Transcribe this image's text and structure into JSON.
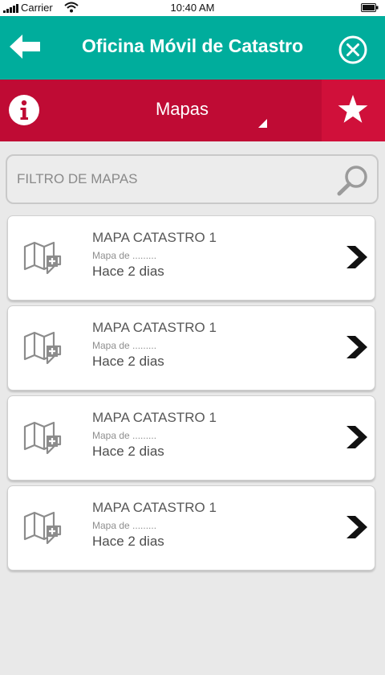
{
  "status_bar": {
    "carrier": "Carrier",
    "time": "10:40 AM"
  },
  "header": {
    "title": "Oficina Móvil de Catastro"
  },
  "section": {
    "title": "Mapas"
  },
  "search": {
    "placeholder": "FILTRO DE MAPAS"
  },
  "maps": [
    {
      "title": "MAPA CATASTRO 1",
      "subtitle": "Mapa de .........",
      "time": "Hace 2 dias"
    },
    {
      "title": "MAPA CATASTRO 1",
      "subtitle": "Mapa de .........",
      "time": "Hace 2 dias"
    },
    {
      "title": "MAPA CATASTRO 1",
      "subtitle": "Mapa de .........",
      "time": "Hace 2 dias"
    },
    {
      "title": "MAPA CATASTRO 1",
      "subtitle": "Mapa de .........",
      "time": "Hace 2 dias"
    }
  ],
  "icons": {
    "back": "arrow-left-icon",
    "close": "close-circle-icon",
    "info": "info-icon",
    "favorite": "star-icon",
    "search": "search-icon",
    "map": "map-add-icon",
    "chevron": "chevron-right-icon"
  },
  "colors": {
    "header": "#00ad9c",
    "section_bar": "#bf0b34",
    "favorite_button": "#d0103a",
    "background": "#e9e9e9"
  }
}
